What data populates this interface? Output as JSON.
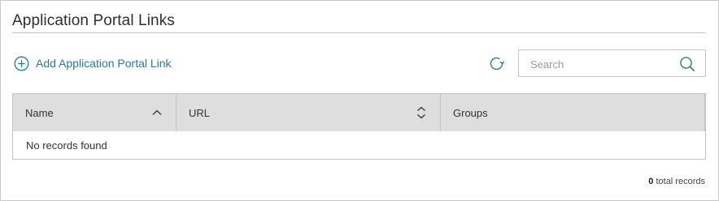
{
  "page": {
    "title": "Application Portal Links"
  },
  "toolbar": {
    "add_label": "Add Application Portal Link",
    "add_icon": "plus-circle-icon",
    "refresh_icon": "refresh-icon"
  },
  "search": {
    "placeholder": "Search",
    "value": "",
    "icon": "search-icon"
  },
  "table": {
    "columns": [
      {
        "label": "Name",
        "sort_icon": "chevron-up-icon"
      },
      {
        "label": "URL",
        "sort_icon": "sort-updown-icon"
      },
      {
        "label": "Groups"
      }
    ],
    "empty_message": "No records found"
  },
  "footer": {
    "count": "0",
    "suffix": " total records"
  },
  "colors": {
    "accent": "#2a7b94",
    "header_bg": "#dedede",
    "border": "#c4c4c4"
  }
}
